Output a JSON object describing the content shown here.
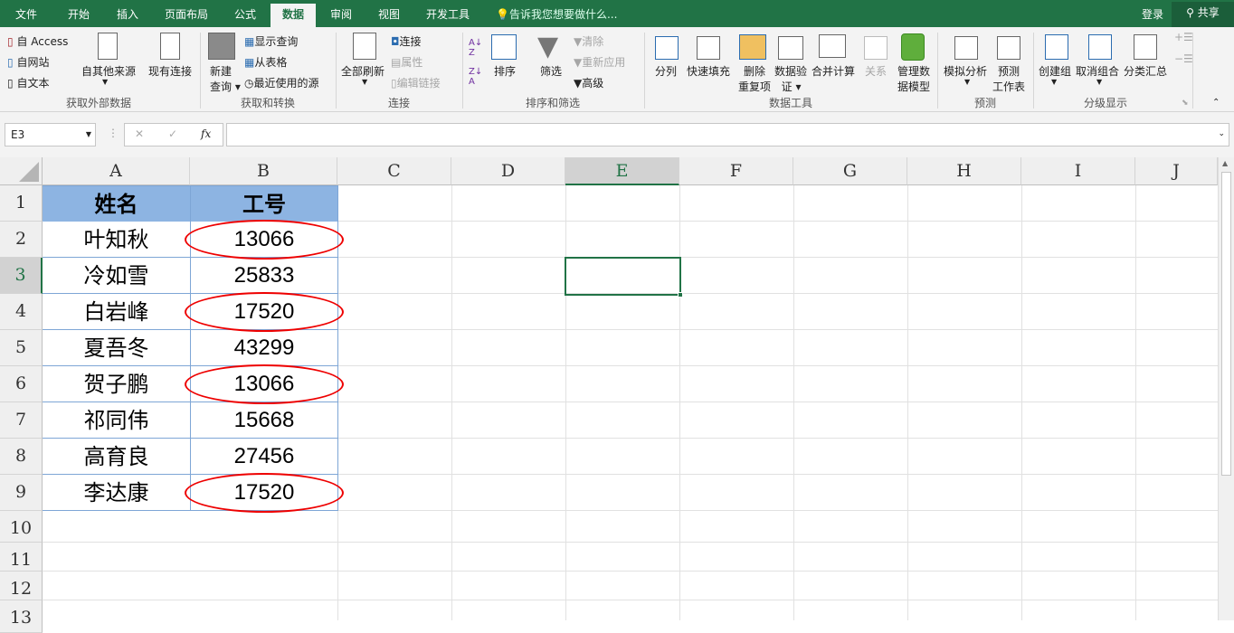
{
  "tabs": [
    "文件",
    "开始",
    "插入",
    "页面布局",
    "公式",
    "数据",
    "审阅",
    "视图",
    "开发工具"
  ],
  "active_tab": "数据",
  "tell_me": "告诉我您想要做什么...",
  "login": "登录",
  "share": "共享",
  "ribbon": {
    "get_external": {
      "label": "获取外部数据",
      "access": "自 Access",
      "web": "自网站",
      "text": "自文本",
      "other": "自其他来源",
      "existing": "现有连接"
    },
    "get_transform": {
      "label": "获取和转换",
      "new_query_1": "新建",
      "new_query_2": "查询",
      "show_queries": "显示查询",
      "from_table": "从表格",
      "recent": "最近使用的源"
    },
    "connections": {
      "label": "连接",
      "refresh_all": "全部刷新",
      "connections": "连接",
      "properties": "属性",
      "edit_links": "编辑链接"
    },
    "sort_filter": {
      "label": "排序和筛选",
      "sort": "排序",
      "filter": "筛选",
      "clear": "清除",
      "reapply": "重新应用",
      "advanced": "高级"
    },
    "data_tools": {
      "label": "数据工具",
      "split": "分列",
      "flash_fill": "快速填充",
      "remove_dup_1": "删除",
      "remove_dup_2": "重复项",
      "validation_1": "数据验",
      "validation_2": "证",
      "consolidate": "合并计算",
      "relationships": "关系",
      "manage_1": "管理数",
      "manage_2": "据模型"
    },
    "forecast": {
      "label": "预测",
      "whatif": "模拟分析",
      "sheet_1": "预测",
      "sheet_2": "工作表"
    },
    "outline": {
      "label": "分级显示",
      "group": "创建组",
      "ungroup": "取消组合",
      "subtotal": "分类汇总"
    }
  },
  "name_box": "E3",
  "fx": "fx",
  "columns": [
    "A",
    "B",
    "C",
    "D",
    "E",
    "F",
    "G",
    "H",
    "I",
    "J"
  ],
  "rows": [
    "1",
    "2",
    "3",
    "4",
    "5",
    "6",
    "7",
    "8",
    "9",
    "10",
    "11",
    "12",
    "13"
  ],
  "table": {
    "headers": [
      "姓名",
      "工号"
    ],
    "data": [
      [
        "叶知秋",
        "13066"
      ],
      [
        "冷如雪",
        "25833"
      ],
      [
        "白岩峰",
        "17520"
      ],
      [
        "夏吾冬",
        "43299"
      ],
      [
        "贺子鹏",
        "13066"
      ],
      [
        "祁同伟",
        "15668"
      ],
      [
        "高育良",
        "27456"
      ],
      [
        "李达康",
        "17520"
      ]
    ],
    "circled_rows": [
      0,
      2,
      4,
      7
    ]
  },
  "colors": {
    "accent": "#217346",
    "header_fill": "#8db4e2",
    "circle": "#e00000"
  }
}
